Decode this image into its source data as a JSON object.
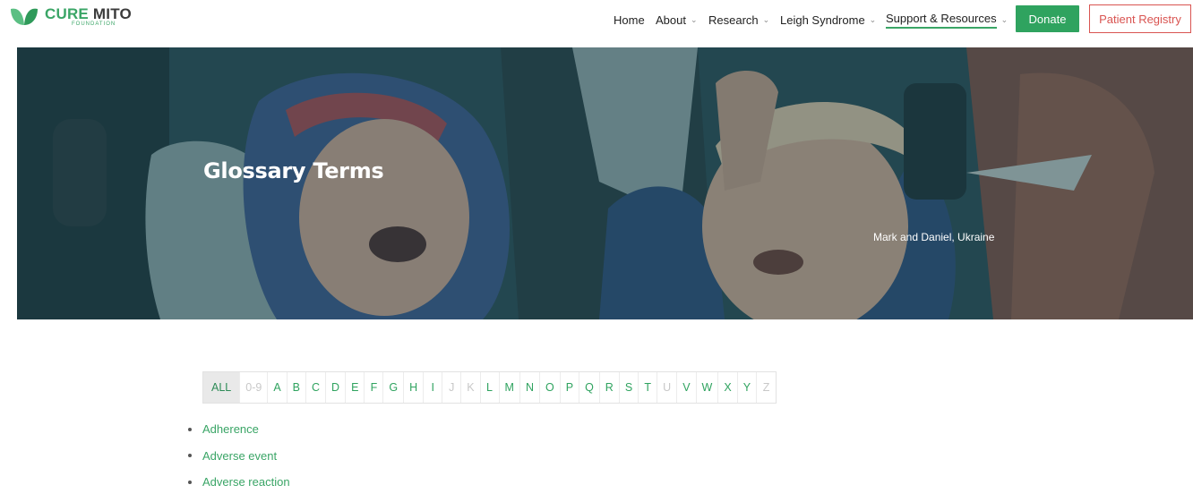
{
  "brand": {
    "name_part1": "CURE",
    "name_part2": "MITO",
    "subtitle": "FOUNDATION",
    "color": "#3aa566"
  },
  "nav": {
    "items": [
      {
        "label": "Home",
        "has_dropdown": false,
        "active": false
      },
      {
        "label": "About",
        "has_dropdown": true,
        "active": false
      },
      {
        "label": "Research",
        "has_dropdown": true,
        "active": false
      },
      {
        "label": "Leigh Syndrome",
        "has_dropdown": true,
        "active": false
      },
      {
        "label": "Support & Resources",
        "has_dropdown": true,
        "active": true
      }
    ],
    "donate_label": "Donate",
    "registry_label": "Patient Registry",
    "chevron_icon": "chevron-down-icon"
  },
  "hero": {
    "title": "Glossary Terms",
    "caption": "Mark and Daniel, Ukraine"
  },
  "glossary": {
    "letters": [
      {
        "label": "ALL",
        "state": "selected"
      },
      {
        "label": "0-9",
        "state": "disabled"
      },
      {
        "label": "A",
        "state": "enabled"
      },
      {
        "label": "B",
        "state": "enabled"
      },
      {
        "label": "C",
        "state": "enabled"
      },
      {
        "label": "D",
        "state": "enabled"
      },
      {
        "label": "E",
        "state": "enabled"
      },
      {
        "label": "F",
        "state": "enabled"
      },
      {
        "label": "G",
        "state": "enabled"
      },
      {
        "label": "H",
        "state": "enabled"
      },
      {
        "label": "I",
        "state": "enabled"
      },
      {
        "label": "J",
        "state": "disabled"
      },
      {
        "label": "K",
        "state": "disabled"
      },
      {
        "label": "L",
        "state": "enabled"
      },
      {
        "label": "M",
        "state": "enabled"
      },
      {
        "label": "N",
        "state": "enabled"
      },
      {
        "label": "O",
        "state": "enabled"
      },
      {
        "label": "P",
        "state": "enabled"
      },
      {
        "label": "Q",
        "state": "enabled"
      },
      {
        "label": "R",
        "state": "enabled"
      },
      {
        "label": "S",
        "state": "enabled"
      },
      {
        "label": "T",
        "state": "enabled"
      },
      {
        "label": "U",
        "state": "disabled"
      },
      {
        "label": "V",
        "state": "enabled"
      },
      {
        "label": "W",
        "state": "enabled"
      },
      {
        "label": "X",
        "state": "enabled"
      },
      {
        "label": "Y",
        "state": "enabled"
      },
      {
        "label": "Z",
        "state": "disabled"
      }
    ],
    "terms": [
      "Adherence",
      "Adverse event",
      "Adverse reaction"
    ]
  },
  "colors": {
    "accent": "#2fa35f",
    "registry": "#d95451",
    "disabled_letter": "#c8c8c8"
  }
}
